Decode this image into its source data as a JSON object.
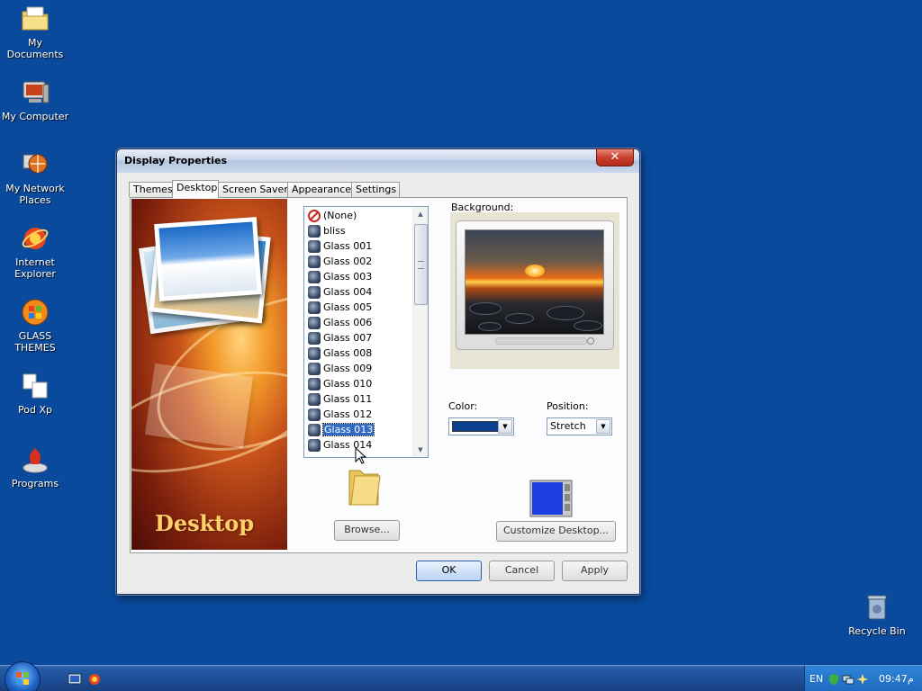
{
  "desktop": {
    "icons": [
      {
        "label": "My Documents",
        "icon": "my-documents-folder-icon"
      },
      {
        "label": "My Computer",
        "icon": "my-computer-icon"
      },
      {
        "label": "My Network Places",
        "icon": "network-places-icon"
      },
      {
        "label": "Internet Explorer",
        "icon": "internet-explorer-icon"
      },
      {
        "label": "GLASS THEMES",
        "icon": "windows-logo-icon"
      },
      {
        "label": "Pod Xp",
        "icon": "document-icon"
      },
      {
        "label": "Programs",
        "icon": "programs-icon"
      }
    ],
    "recycle_bin": {
      "label": "Recycle Bin",
      "icon": "recycle-bin-icon"
    },
    "background_color": "#0a4a9c"
  },
  "dialog": {
    "title": "Display Properties",
    "close_glyph": "✕",
    "tabs": [
      {
        "label": "Themes",
        "active": false
      },
      {
        "label": "Desktop",
        "active": true
      },
      {
        "label": "Screen Saver",
        "active": false
      },
      {
        "label": "Appearance",
        "active": false
      },
      {
        "label": "Settings",
        "active": false
      }
    ],
    "banner_title": "Desktop",
    "background_list": {
      "items": [
        {
          "label": "(None)",
          "icon": "none-icon"
        },
        {
          "label": "bliss",
          "icon": "image-icon"
        },
        {
          "label": "Glass 001",
          "icon": "image-icon"
        },
        {
          "label": "Glass 002",
          "icon": "image-icon"
        },
        {
          "label": "Glass 003",
          "icon": "image-icon"
        },
        {
          "label": "Glass 004",
          "icon": "image-icon"
        },
        {
          "label": "Glass 005",
          "icon": "image-icon"
        },
        {
          "label": "Glass 006",
          "icon": "image-icon"
        },
        {
          "label": "Glass 007",
          "icon": "image-icon"
        },
        {
          "label": "Glass 008",
          "icon": "image-icon"
        },
        {
          "label": "Glass 009",
          "icon": "image-icon"
        },
        {
          "label": "Glass 010",
          "icon": "image-icon"
        },
        {
          "label": "Glass 011",
          "icon": "image-icon"
        },
        {
          "label": "Glass 012",
          "icon": "image-icon"
        },
        {
          "label": "Glass 013",
          "icon": "image-icon",
          "selected": true
        },
        {
          "label": "Glass 014",
          "icon": "image-icon"
        }
      ],
      "selected": "Glass 013"
    },
    "background_label": "Background:",
    "color_label": "Color:",
    "color_value": "#0c3f8c",
    "position_label": "Position:",
    "position_value": "Stretch",
    "browse_label": "Browse...",
    "customize_label": "Customize Desktop...",
    "ok_label": "OK",
    "cancel_label": "Cancel",
    "apply_label": "Apply"
  },
  "taskbar": {
    "quick_launch": [
      "show-desktop-icon",
      "internet-explorer-icon"
    ],
    "tray": {
      "language": "EN",
      "time": "09:47",
      "ampm": "م"
    }
  }
}
